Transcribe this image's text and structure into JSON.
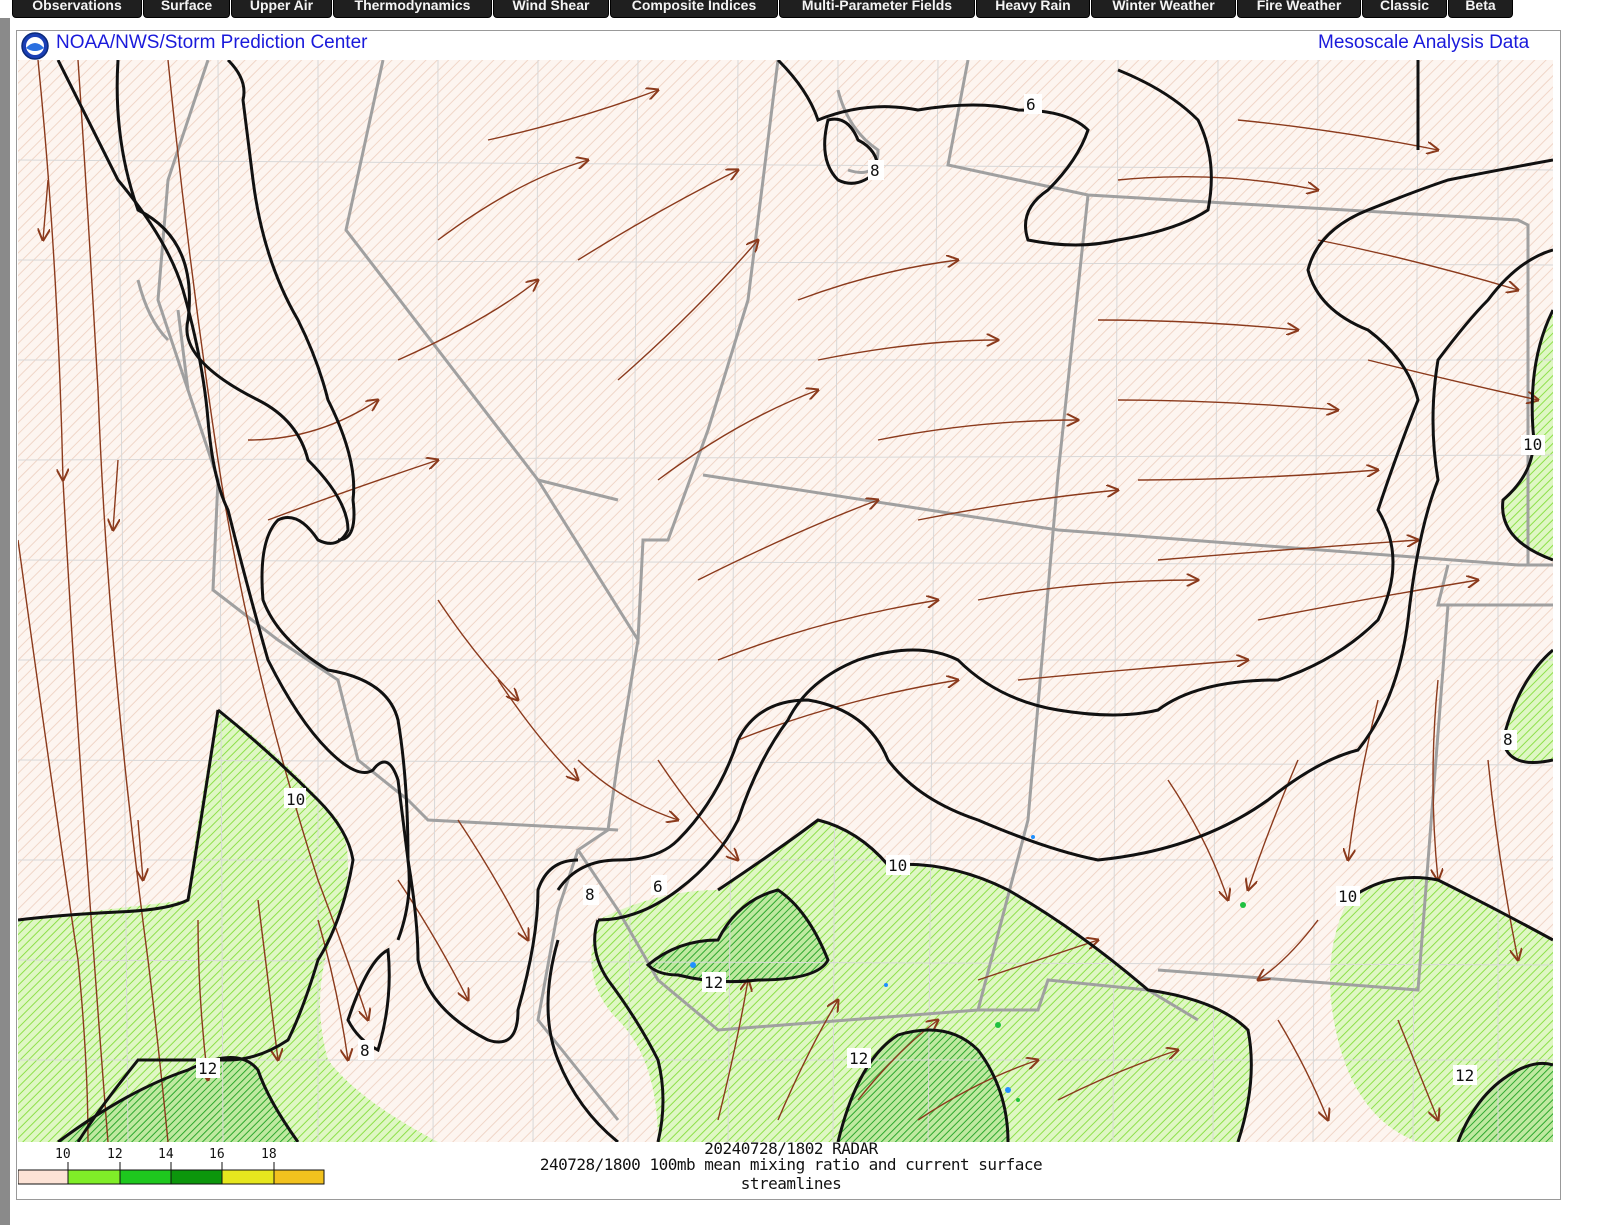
{
  "nav": {
    "tabs": [
      "Observations",
      "Surface",
      "Upper Air",
      "Thermodynamics",
      "Wind Shear",
      "Composite Indices",
      "Multi-Parameter Fields",
      "Heavy Rain",
      "Winter Weather",
      "Fire Weather",
      "Classic",
      "Beta"
    ]
  },
  "header": {
    "left_title": "NOAA/NWS/Storm Prediction Center",
    "right_title": "Mesoscale Analysis Data"
  },
  "map": {
    "contour_labels": [
      "6",
      "8",
      "10",
      "12"
    ],
    "caption_radar": "20240728/1802 RADAR",
    "caption_product": "240728/1800 100mb mean mixing ratio and current surface streamlines"
  },
  "legend": {
    "items": [
      {
        "label": "10",
        "color": "#fde3d6"
      },
      {
        "label": "12",
        "color": "#80ee28"
      },
      {
        "label": "14",
        "color": "#1ec81e"
      },
      {
        "label": "16",
        "color": "#0c960c"
      },
      {
        "label": "18",
        "color": "#e6e61e"
      },
      {
        "label": "",
        "color": "#f2c21e"
      }
    ]
  },
  "colors": {
    "nav_bg": "#1f1f1f",
    "title_blue": "#1a1adb",
    "streamline": "#8b3a1c",
    "moist_fill": "#c8f0a0",
    "dry_fill": "#fcf0ea",
    "border_gray": "#a0a0a0"
  }
}
